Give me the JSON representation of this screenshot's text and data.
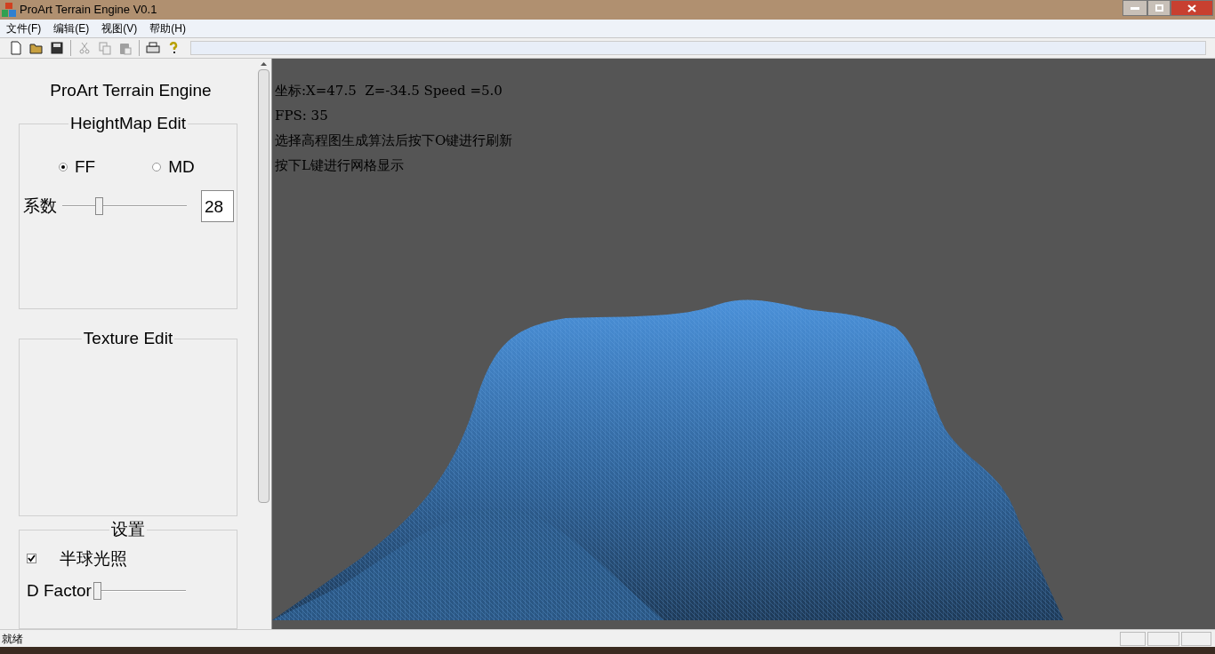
{
  "window": {
    "title": "ProArt Terrain Engine V0.1"
  },
  "menu": [
    "文件(F)",
    "编辑(E)",
    "视图(V)",
    "帮助(H)"
  ],
  "toolbar": [
    {
      "kind": "new",
      "disabled": false
    },
    {
      "kind": "open",
      "disabled": false
    },
    {
      "kind": "save",
      "disabled": false
    },
    {
      "kind": "sep"
    },
    {
      "kind": "cut",
      "disabled": true
    },
    {
      "kind": "copy",
      "disabled": true
    },
    {
      "kind": "paste",
      "disabled": true
    },
    {
      "kind": "sep"
    },
    {
      "kind": "print",
      "disabled": false
    },
    {
      "kind": "help",
      "disabled": false
    }
  ],
  "sidebar": {
    "title": "ProArt Terrain Engine",
    "heightmap": {
      "title": "HeightMap Edit",
      "options": [
        {
          "label": "FF",
          "selected": true
        },
        {
          "label": "MD",
          "selected": false
        }
      ],
      "coef_label": "系数",
      "level": 0.3,
      "value": "28"
    },
    "texture": {
      "title": "Texture Edit"
    },
    "settings": {
      "title": "设置",
      "hemisphere": {
        "label": "半球光照",
        "checked": true
      },
      "dfactor": {
        "label": "D Factor",
        "level": 0
      }
    }
  },
  "viewport": {
    "lines": [
      "坐标:X=47.5  Z=-34.5 Speed =5.0",
      "FPS: 35",
      "选择高程图生成算法后按下O键进行刷新",
      "按下L键进行网格显示"
    ]
  },
  "status_bar": {
    "text": "就绪"
  }
}
